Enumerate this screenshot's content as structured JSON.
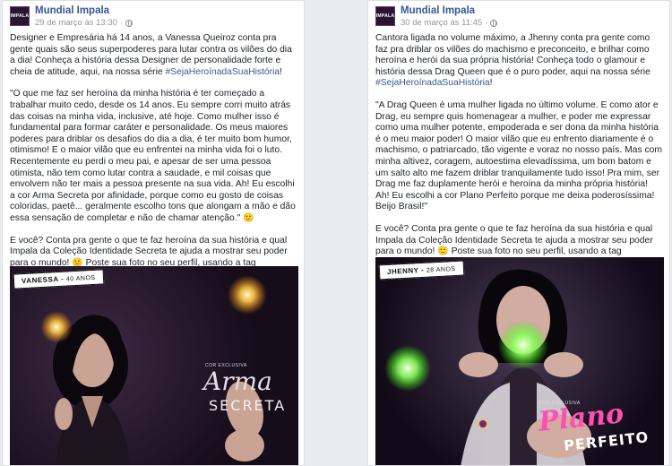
{
  "posts": [
    {
      "page_name": "Mundial Impala",
      "avatar_text": "IMPALA",
      "timestamp": "29 de março às 13:30",
      "intro": "Designer e Empresária há 14 anos, a Vanessa Queiroz conta pra gente quais são seus superpoderes para lutar contra os vilões do dia a dia! Conheça a história dessa Designer de personalidade forte e cheia de atitude, aqui, na nossa série ",
      "intro_hashtag": "#SejaHeroínadaSuaHistória",
      "intro_end": "!",
      "quote": "\"O que me faz ser heroína da minha história é ter começado a trabalhar muito cedo, desde os 14 anos. Eu sempre corri muito atrás das coisas na minha vida, inclusive, até hoje. Como mulher isso é fundamental para formar caráter e personalidade. Os meus maiores poderes para driblar os desafios do dia a dia, é ter muito bom humor, otimismo! E o maior vilão que eu enfrentei na minha vida foi o luto. Recentemente eu perdi o meu pai, e apesar de ser uma pessoa otimista, não tem como lutar contra a saudade, e mil coisas que envolvem não ter mais a pessoa presente na sua vida. Ah! Eu escolhi a cor Arma Secreta por afinidade, porque como eu gosto de coisas coloridas, paetê... geralmente escolho tons que alongam a mão e dão essa sensação de completar e não de chamar atenção.\"",
      "cta_1": "E você? Conta pra gente o que te faz heroína da sua história e qual Impala da Coleção Identidade Secreta te ajuda a mostrar seu poder para o mundo!",
      "cta_2": " Poste sua foto no seu perfil, usando a tag #SejaHeroínadaSuaHistória e compartilhe sua história com a gente. As 3 melhores histórias serão postadas nos nossos canais. Arrasem! ",
      "image": {
        "name_label": "VANESSA",
        "age_label": "40 ANOS",
        "collection": "COR EXCLUSIVA",
        "title_line1": "Arma",
        "title_line2": "SECRETA"
      }
    },
    {
      "page_name": "Mundial Impala",
      "avatar_text": "IMPALA",
      "timestamp": "30 de março às 11:45",
      "intro": "Cantora ligada no volume máximo, a Jhenny conta pra gente como faz pra driblar os vilões do machismo e preconceito, e brilhar como heroína e herói da sua própria história! Conheça todo o glamour e história dessa Drag Queen que é o puro poder, aqui na nossa série ",
      "intro_hashtag": "#SejaHeroínadaSuaHistória",
      "intro_end": "!",
      "quote": "\"A Drag Queen é uma mulher ligada no último volume. E como ator e Drag, eu sempre quis homenagear a mulher, e poder me expressar como uma mulher potente, empoderada e ser dona da minha história é o meu maior poder! O maior vilão que eu enfrento diariamente é o machismo, o patriarcado, tão vigente e voraz no nosso país. Mas com minha altivez, coragem, autoestima elevadíssima, um bom batom e um salto alto me fazem driblar tranquilamente tudo isso! Pra mim, ser Drag me faz duplamente herói e heroína da minha própria história! Ah! Eu escolhi a cor Plano Perfeito porque me deixa poderosíssima! Beijo Brasil!\"",
      "cta_1": "E você? Conta pra gente o que te faz heroína da sua história e qual Impala da Coleção Identidade Secreta te ajuda a mostrar seu poder para o mundo!",
      "cta_2": " Poste sua foto no seu perfil, usando a tag #SejaHeroínadaSuaHistória e compartilhe sua história com a gente. As 3 melhores histórias serão postadas nos nossos canais. Arrasem! ",
      "image": {
        "name_label": "JHENNY",
        "age_label": "28 ANOS",
        "collection": "COR EXCLUSIVA",
        "title_line1": "Plano",
        "title_line2": "PERFEITO"
      }
    }
  ],
  "icons": {
    "globe": "globe-icon",
    "smile": "smile-emoji",
    "heart": "heart-emoji"
  },
  "colors": {
    "link": "#365899",
    "meta": "#90949c",
    "accent_pink": "#ff4fb3"
  }
}
